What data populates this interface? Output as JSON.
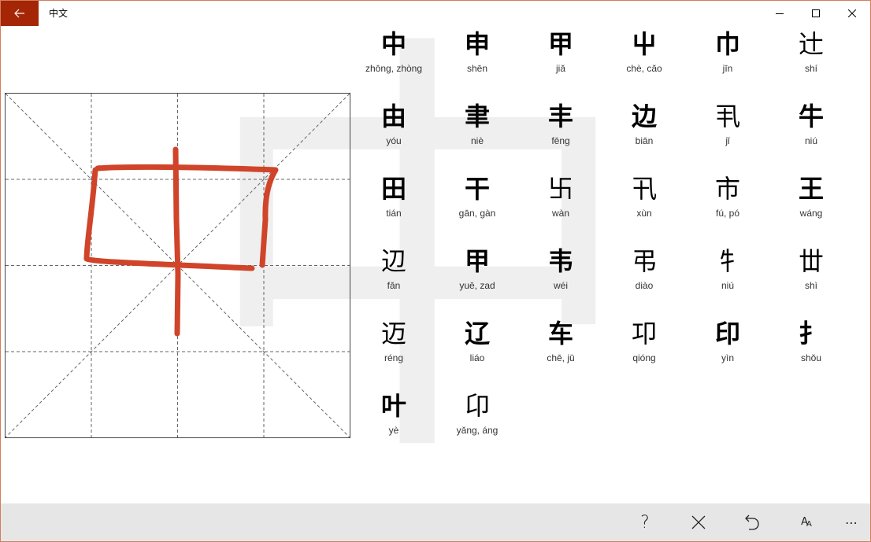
{
  "window": {
    "title": "中文",
    "controls": [
      "minimize-icon",
      "maximize-icon",
      "close-icon"
    ]
  },
  "watermark": {
    "character": "中"
  },
  "colors": {
    "accent": "#a52606",
    "ink": "#d0442a",
    "border": "#d27f5b",
    "cmdbar": "#e6e6e6"
  },
  "candidates": [
    {
      "char": "中",
      "pinyin": "zhōng, zhòng"
    },
    {
      "char": "申",
      "pinyin": "shēn"
    },
    {
      "char": "甲",
      "pinyin": "jiǎ"
    },
    {
      "char": "屮",
      "pinyin": "chè, cǎo"
    },
    {
      "char": "巾",
      "pinyin": "jīn"
    },
    {
      "char": "辻",
      "pinyin": "shí"
    },
    {
      "char": "由",
      "pinyin": "yóu"
    },
    {
      "char": "聿",
      "pinyin": "niè"
    },
    {
      "char": "丰",
      "pinyin": "fēng"
    },
    {
      "char": "边",
      "pinyin": "biān"
    },
    {
      "char": "丮",
      "pinyin": "jǐ"
    },
    {
      "char": "牛",
      "pinyin": "niú"
    },
    {
      "char": "田",
      "pinyin": "tián"
    },
    {
      "char": "干",
      "pinyin": "gān, gàn"
    },
    {
      "char": "卐",
      "pinyin": "wàn"
    },
    {
      "char": "卂",
      "pinyin": "xùn"
    },
    {
      "char": "市",
      "pinyin": "fú, pó"
    },
    {
      "char": "王",
      "pinyin": "wáng"
    },
    {
      "char": "辺",
      "pinyin": "fǎn"
    },
    {
      "char": "甲",
      "pinyin": "yuē, zad"
    },
    {
      "char": "韦",
      "pinyin": "wéi"
    },
    {
      "char": "弔",
      "pinyin": "diào"
    },
    {
      "char": "牜",
      "pinyin": "niú"
    },
    {
      "char": "丗",
      "pinyin": "shì"
    },
    {
      "char": "迈",
      "pinyin": "réng"
    },
    {
      "char": "辽",
      "pinyin": "liáo"
    },
    {
      "char": "车",
      "pinyin": "chē, jū"
    },
    {
      "char": "卭",
      "pinyin": "qióng"
    },
    {
      "char": "印",
      "pinyin": "yìn"
    },
    {
      "char": "扌",
      "pinyin": "shǒu"
    },
    {
      "char": "叶",
      "pinyin": "yè"
    },
    {
      "char": "卬",
      "pinyin": "yǎng, áng"
    }
  ],
  "commands": [
    {
      "icon": "help-icon",
      "glyph": "?"
    },
    {
      "icon": "clear-icon",
      "glyph": "✕"
    },
    {
      "icon": "undo-icon",
      "glyph": "↶"
    },
    {
      "icon": "font-size-icon",
      "glyph": "AA"
    },
    {
      "icon": "more-icon",
      "glyph": "⋯"
    }
  ]
}
